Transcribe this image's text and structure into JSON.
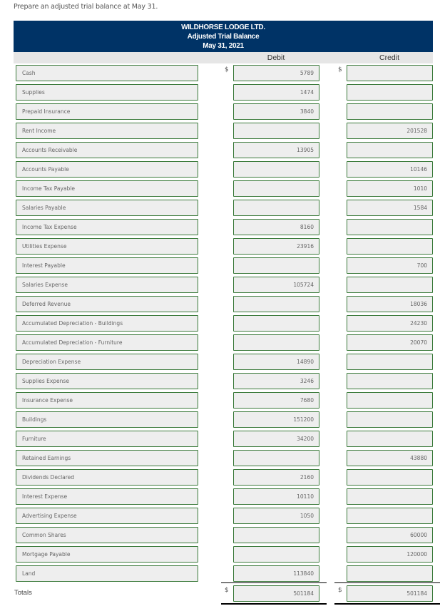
{
  "instruction": "Prepare an adjusted trial balance at May 31.",
  "header": {
    "company": "WILDHORSE LODGE LTD.",
    "title": "Adjusted Trial Balance",
    "date": "May 31, 2021"
  },
  "columns": {
    "debit": "Debit",
    "credit": "Credit"
  },
  "currency_symbol": "$",
  "rows": [
    {
      "account": "Cash",
      "debit": "5789",
      "credit": ""
    },
    {
      "account": "Supplies",
      "debit": "1474",
      "credit": ""
    },
    {
      "account": "Prepaid Insurance",
      "debit": "3840",
      "credit": ""
    },
    {
      "account": "Rent Income",
      "debit": "",
      "credit": "201528"
    },
    {
      "account": "Accounts Receivable",
      "debit": "13905",
      "credit": ""
    },
    {
      "account": "Accounts Payable",
      "debit": "",
      "credit": "10146"
    },
    {
      "account": "Income Tax Payable",
      "debit": "",
      "credit": "1010"
    },
    {
      "account": "Salaries Payable",
      "debit": "",
      "credit": "1584"
    },
    {
      "account": "Income Tax Expense",
      "debit": "8160",
      "credit": ""
    },
    {
      "account": "Utilities Expense",
      "debit": "23916",
      "credit": ""
    },
    {
      "account": "Interest Payable",
      "debit": "",
      "credit": "700"
    },
    {
      "account": "Salaries Expense",
      "debit": "105724",
      "credit": ""
    },
    {
      "account": "Deferred Revenue",
      "debit": "",
      "credit": "18036"
    },
    {
      "account": "Accumulated Depreciation - Buildings",
      "debit": "",
      "credit": "24230"
    },
    {
      "account": "Accumulated Depreciation - Furniture",
      "debit": "",
      "credit": "20070"
    },
    {
      "account": "Depreciation Expense",
      "debit": "14890",
      "credit": ""
    },
    {
      "account": "Supplies Expense",
      "debit": "3246",
      "credit": ""
    },
    {
      "account": "Insurance Expense",
      "debit": "7680",
      "credit": ""
    },
    {
      "account": "Buildings",
      "debit": "151200",
      "credit": ""
    },
    {
      "account": "Furniture",
      "debit": "34200",
      "credit": ""
    },
    {
      "account": "Retained Earnings",
      "debit": "",
      "credit": "43880"
    },
    {
      "account": "Dividends Declared",
      "debit": "2160",
      "credit": ""
    },
    {
      "account": "Interest Expense",
      "debit": "10110",
      "credit": ""
    },
    {
      "account": "Advertising Expense",
      "debit": "1050",
      "credit": ""
    },
    {
      "account": "Common Shares",
      "debit": "",
      "credit": "60000"
    },
    {
      "account": "Mortgage Payable",
      "debit": "",
      "credit": "120000"
    },
    {
      "account": "Land",
      "debit": "113840",
      "credit": ""
    }
  ],
  "totals": {
    "label": "Totals",
    "debit": "501184",
    "credit": "501184"
  },
  "colors": {
    "header_bg": "#003366",
    "input_border": "#3a7a3a",
    "input_bg": "#eeeeee"
  }
}
